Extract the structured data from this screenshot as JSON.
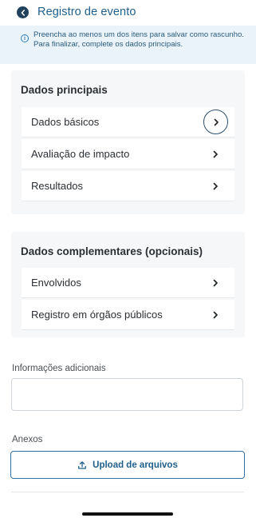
{
  "header": {
    "title": "Registro de evento"
  },
  "info": {
    "text": "Preencha ao menos um dos itens para salvar como rascunho. Para finalizar, complete os dados principais."
  },
  "main_section": {
    "title": "Dados principais",
    "items": [
      {
        "label": "Dados básicos"
      },
      {
        "label": "Avaliação de impacto"
      },
      {
        "label": "Resultados"
      }
    ]
  },
  "complementary_section": {
    "title": "Dados complementares (opcionais)",
    "items": [
      {
        "label": "Envolvidos"
      },
      {
        "label": "Registro em órgãos públicos"
      }
    ]
  },
  "additional_info": {
    "label": "Informações adicionais",
    "value": ""
  },
  "attachments": {
    "label": "Anexos",
    "upload_label": "Upload de arquivos"
  },
  "colors": {
    "accent": "#1f5f8b",
    "banner": "#eaf3f9",
    "section_bg": "#f6f7f8"
  }
}
